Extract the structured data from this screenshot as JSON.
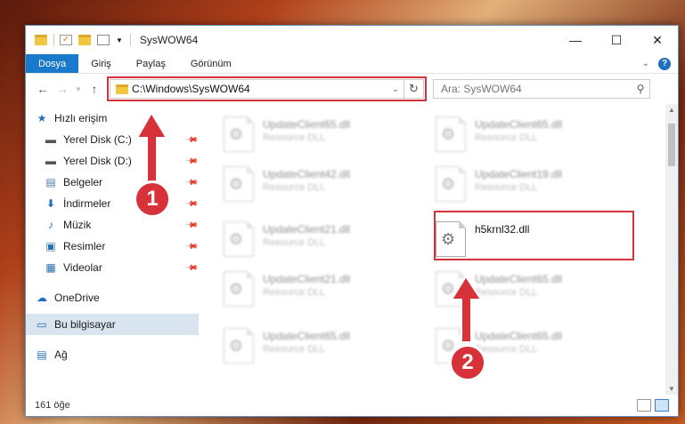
{
  "window": {
    "title": "SysWOW64",
    "controls": {
      "minimize": "—",
      "maximize": "☐",
      "close": "✕"
    }
  },
  "ribbon": {
    "tabs": [
      "Dosya",
      "Giriş",
      "Paylaş",
      "Görünüm"
    ],
    "expand_icon": "chevron-down-icon",
    "help_label": "?"
  },
  "address": {
    "path": "C:\\Windows\\SysWOW64",
    "search_placeholder": "Ara: SysWOW64"
  },
  "sidebar": {
    "items": [
      {
        "label": "Hızlı erişim",
        "icon": "star-icon",
        "pinned": false
      },
      {
        "label": "Yerel Disk (C:)",
        "icon": "drive-icon",
        "pinned": true
      },
      {
        "label": "Yerel Disk (D:)",
        "icon": "drive-icon",
        "pinned": true
      },
      {
        "label": "Belgeler",
        "icon": "documents-icon",
        "pinned": true
      },
      {
        "label": "İndirmeler",
        "icon": "download-icon",
        "pinned": true
      },
      {
        "label": "Müzik",
        "icon": "music-icon",
        "pinned": true
      },
      {
        "label": "Resimler",
        "icon": "pictures-icon",
        "pinned": true
      },
      {
        "label": "Videolar",
        "icon": "videos-icon",
        "pinned": true
      },
      {
        "label": "OneDrive",
        "icon": "cloud-icon"
      },
      {
        "label": "Bu bilgisayar",
        "icon": "computer-icon",
        "selected": true
      },
      {
        "label": "Ağ",
        "icon": "network-icon"
      }
    ]
  },
  "files": [
    {
      "name": "UpdateClient65.dll",
      "type": "Resource DLL"
    },
    {
      "name": "UpdateClient65.dll",
      "type": "Resource DLL"
    },
    {
      "name": "UpdateClient42.dll",
      "type": "Resource DLL"
    },
    {
      "name": "UpdateClient19.dll",
      "type": "Resource DLL"
    },
    {
      "name": "UpdateClient21.dll",
      "type": "Resource DLL"
    },
    {
      "name": "h5krnl32.dll",
      "type": ""
    },
    {
      "name": "UpdateClient21.dll",
      "type": "Resource DLL"
    },
    {
      "name": "UpdateClient65.dll",
      "type": "Resource DLL"
    },
    {
      "name": "UpdateClient65.dll",
      "type": "Resource DLL"
    },
    {
      "name": "UpdateClient65.dll",
      "type": "Resource DLL"
    }
  ],
  "callouts": [
    "1",
    "2"
  ],
  "status": {
    "count": "161 öğe"
  },
  "colors": {
    "accent": "#1979ca",
    "highlight": "#d7323a",
    "selected_nav": "#d9e4f1"
  }
}
